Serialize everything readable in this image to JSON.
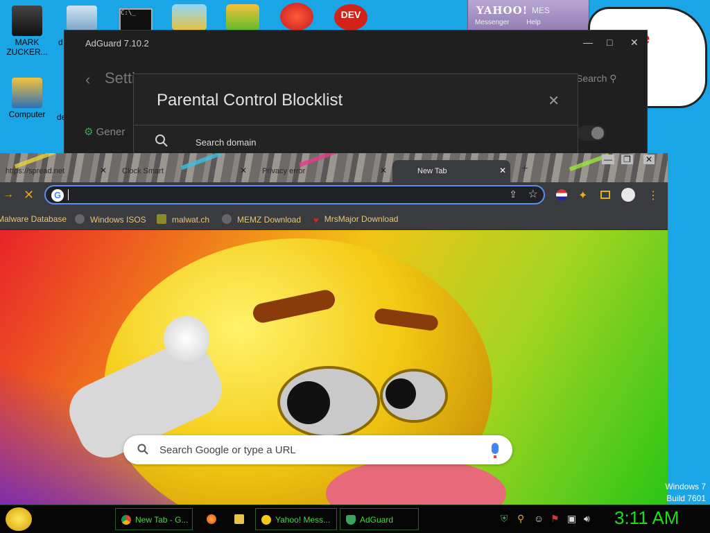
{
  "desktop": {
    "icons": [
      {
        "label": "MARK ZUCKER..."
      },
      {
        "label": "Computer"
      },
      {
        "label": "d"
      },
      {
        "label": "de"
      }
    ],
    "os_label_line1": "Windows 7",
    "os_label_line2": "Build 7601"
  },
  "yahoo_window": {
    "title": "YAHOO!",
    "title_suffix": "MES",
    "menu": [
      "Messenger",
      "Help"
    ]
  },
  "adguard": {
    "window_title": "AdGuard 7.10.2",
    "controls": {
      "minimize": "—",
      "maximize": "□",
      "close": "✕"
    },
    "page_title": "Setti",
    "search_label": "Search",
    "general_label": "Gener",
    "dialog": {
      "title": "Parental Control Blocklist",
      "close": "✕",
      "search_placeholder": "Search domain"
    }
  },
  "chrome": {
    "tabs": [
      {
        "label": "https://spread.net",
        "active": false
      },
      {
        "label": "Clock Smart",
        "active": false
      },
      {
        "label": "Privacy error",
        "active": false
      },
      {
        "label": "New Tab",
        "active": true
      }
    ],
    "new_tab": "+",
    "window_controls": {
      "minimize": "—",
      "maximize": "❐",
      "close": "✕"
    },
    "address_bar": {
      "value": "",
      "placeholder": ""
    },
    "bookmarks": [
      {
        "label": "Malware Database"
      },
      {
        "label": "Windows ISOS"
      },
      {
        "label": "malwat.ch"
      },
      {
        "label": "MEMZ Download"
      },
      {
        "label": "MrsMajor Download"
      }
    ],
    "ntp_search_placeholder": "Search Google or type a URL"
  },
  "taskbar": {
    "buttons": [
      {
        "label": "New Tab - G..."
      },
      {
        "label": ""
      },
      {
        "label": ""
      },
      {
        "label": "Yahoo! Mess..."
      },
      {
        "label": "AdGuard"
      }
    ],
    "clock": "3:11 AM"
  },
  "colors": {
    "desktop_bg": "#1aa6e6",
    "accent_green": "#47d847",
    "clock_green": "#17e017",
    "bookmark_text": "#e8c67c",
    "omnibox_focus": "#5b8ff0"
  }
}
